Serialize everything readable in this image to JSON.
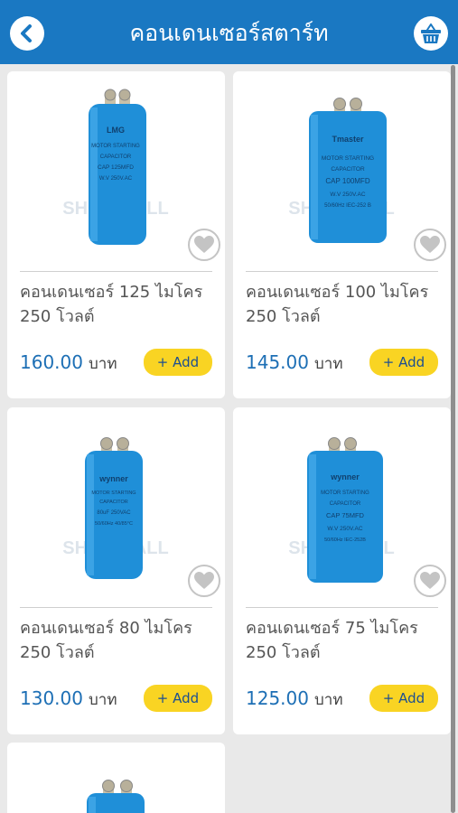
{
  "header": {
    "title": "คอนเดนเซอร์สตาร์ท",
    "back_icon": "chevron-left-icon",
    "cart_icon": "basket-icon",
    "color": "#1a78c2"
  },
  "products": [
    {
      "name": "คอนเดนเซอร์ 125 ไมโคร 250 โวลต์",
      "price": "160.00",
      "currency": "บาท",
      "add_label": "+ Add",
      "label_text": [
        "LMG",
        "MOTOR STARTING",
        "CAPACITOR",
        "CAP 125MFD",
        "W.V 250V.AC"
      ],
      "watermark": "SHOP MALL"
    },
    {
      "name": "คอนเดนเซอร์ 100 ไมโคร 250 โวลต์",
      "price": "145.00",
      "currency": "บาท",
      "add_label": "+ Add",
      "label_text": [
        "Tmaster",
        "MOTOR STARTING",
        "CAPACITOR",
        "CAP 100MFD",
        "W.V 250V.AC",
        "50/60Hz IEC-252 B"
      ],
      "watermark": "SHOP MALL"
    },
    {
      "name": "คอนเดนเซอร์ 80 ไมโคร 250 โวลต์",
      "price": "130.00",
      "currency": "บาท",
      "add_label": "+ Add",
      "label_text": [
        "wynner",
        "MOTOR STARTING",
        "CAPACITOR",
        "80uF 250VAC",
        "50/60Hz 40/85°C"
      ],
      "watermark": "SHOP MALL"
    },
    {
      "name": "คอนเดนเซอร์ 75 ไมโคร 250 โวลต์",
      "price": "125.00",
      "currency": "บาท",
      "add_label": "+ Add",
      "label_text": [
        "wynner",
        "MOTOR STARTING",
        "CAPACITOR",
        "CAP 75MFD",
        "W.V 250V.AC",
        "50/60Hz IEC-252B"
      ],
      "watermark": "SHOP MALL"
    }
  ],
  "colors": {
    "price": "#1d6fb5",
    "add_button": "#f9d423",
    "capacitor": "#1f8fd8"
  }
}
